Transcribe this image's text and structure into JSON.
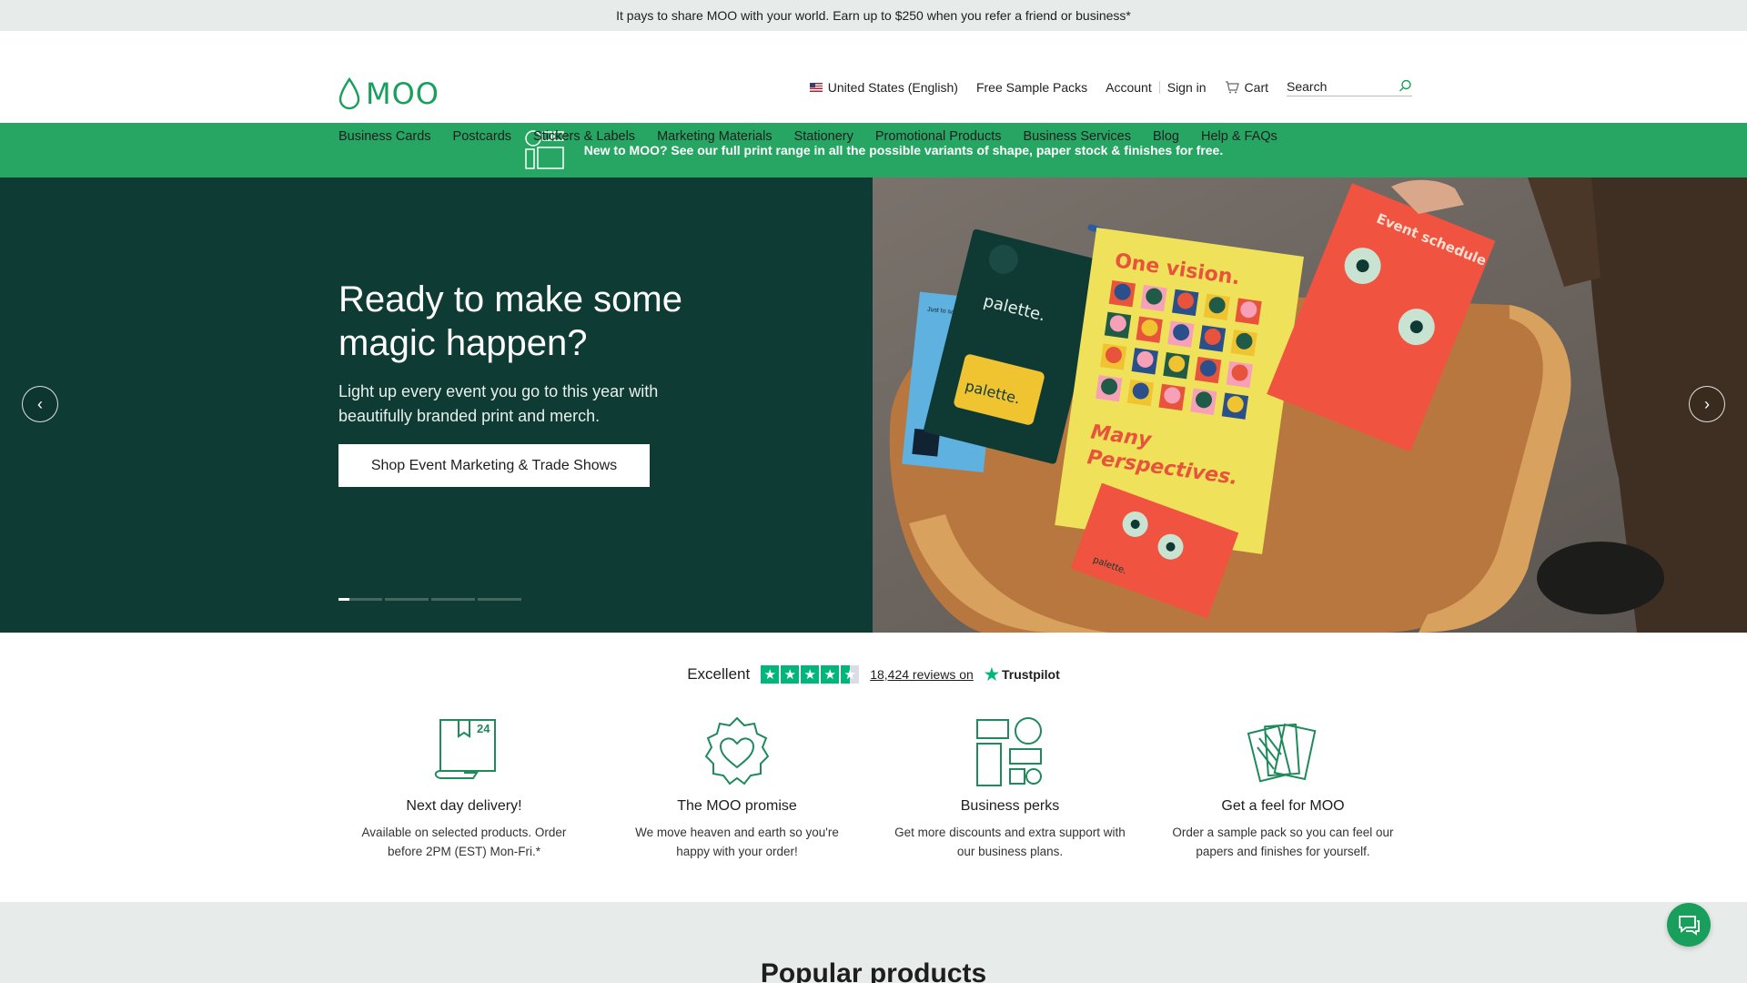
{
  "promo": {
    "text": "It pays to share MOO with your world. Earn up to $250 when you refer a friend or business*"
  },
  "header": {
    "logo": "MOO",
    "locale": "United States (English)",
    "free_samples": "Free Sample Packs",
    "account": "Account",
    "sign_in": "Sign in",
    "cart": "Cart",
    "search_placeholder": "Search"
  },
  "nav": {
    "items": [
      {
        "label": "Business Cards"
      },
      {
        "label": "Postcards"
      },
      {
        "label": "Stickers & Labels"
      },
      {
        "label": "Marketing Materials"
      },
      {
        "label": "Stationery"
      },
      {
        "label": "Promotional Products"
      },
      {
        "label": "Business Services"
      },
      {
        "label": "Blog"
      },
      {
        "label": "Help & FAQs"
      }
    ]
  },
  "banner": {
    "text": "New to MOO? See our full print range in all the possible variants of shape, paper stock & finishes for free."
  },
  "hero": {
    "title": "Ready to make some magic happen?",
    "subtitle": "Light up every event you go to this year with beautifully branded print and merch.",
    "cta": "Shop Event Marketing & Trade Shows",
    "slides": 4,
    "active_slide": 1,
    "image_text": {
      "card": "palette.",
      "vision": "One vision.",
      "perspectives": "Many Perspectives.",
      "schedule": "Event schedule",
      "note": "Just to say..."
    }
  },
  "trustpilot": {
    "rating_word": "Excellent",
    "reviews": "18,424 reviews on",
    "brand": "Trustpilot",
    "stars": 4.5
  },
  "features": [
    {
      "icon": "delivery-box-icon",
      "title": "Next day delivery!",
      "desc": "Available on selected products. Order before 2PM (EST) Mon-Fri.*",
      "badge": "24"
    },
    {
      "icon": "heart-badge-icon",
      "title": "The MOO promise",
      "desc": "We move heaven and earth so you're happy with your order!"
    },
    {
      "icon": "shapes-icon",
      "title": "Business perks",
      "desc": "Get more discounts and extra support with our business plans."
    },
    {
      "icon": "sample-cards-icon",
      "title": "Get a feel for MOO",
      "desc": "Order a sample pack so you can feel our papers and finishes for yourself."
    }
  ],
  "popular": {
    "title": "Popular products"
  },
  "colors": {
    "brand_green": "#17a05d",
    "hero_dark": "#0e3b34",
    "banner_green": "#27a663"
  }
}
